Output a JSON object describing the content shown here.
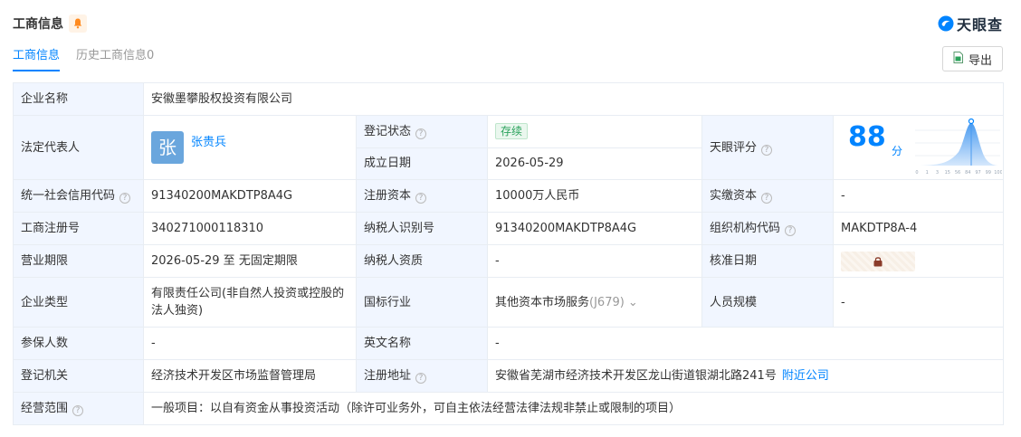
{
  "header": {
    "title": "工商信息",
    "brand": "天眼查"
  },
  "tabs": [
    {
      "label": "工商信息"
    },
    {
      "label": "历史工商信息",
      "count": "0"
    }
  ],
  "toolbar": {
    "export_label": "导出"
  },
  "company": {
    "name_label": "企业名称",
    "name": "安徽墨攀股权投资有限公司",
    "legal_rep_label": "法定代表人",
    "legal_rep_avatar": "张",
    "legal_rep": "张贵兵",
    "reg_status_label": "登记状态",
    "reg_status": "存续",
    "established_label": "成立日期",
    "established": "2026-05-29",
    "score_label": "天眼评分",
    "score": "88",
    "score_unit": "分",
    "score_axis": [
      "0",
      "1",
      "3",
      "15",
      "56",
      "84",
      "97",
      "99",
      "100"
    ],
    "credit_code_label": "统一社会信用代码",
    "credit_code": "91340200MAKDTP8A4G",
    "reg_capital_label": "注册资本",
    "reg_capital": "10000万人民币",
    "paid_capital_label": "实缴资本",
    "paid_capital": "-",
    "reg_no_label": "工商注册号",
    "reg_no": "340271000118310",
    "taxpayer_id_label": "纳税人识别号",
    "taxpayer_id": "91340200MAKDTP8A4G",
    "org_code_label": "组织机构代码",
    "org_code": "MAKDTP8A-4",
    "term_label": "营业期限",
    "term": "2026-05-29 至 无固定期限",
    "taxpayer_qual_label": "纳税人资质",
    "taxpayer_qual": "-",
    "approval_date_label": "核准日期",
    "type_label": "企业类型",
    "type": "有限责任公司(非自然人投资或控股的法人独资)",
    "industry_label": "国标行业",
    "industry": "其他资本市场服务",
    "industry_code": "(J679)",
    "staff_size_label": "人员规模",
    "staff_size": "-",
    "insured_label": "参保人数",
    "insured": "-",
    "english_name_label": "英文名称",
    "english_name": "-",
    "authority_label": "登记机关",
    "authority": "经济技术开发区市场监督管理局",
    "address_label": "注册地址",
    "address": "安徽省芜湖市经济技术开发区龙山街道银湖北路241号",
    "nearby_label": "附近公司",
    "scope_label": "经营范围",
    "scope": "一般项目：以自有资金从事投资活动（除许可业务外，可自主依法经营法律法规非禁止或限制的项目）"
  },
  "colors": {
    "accent": "#0084ff",
    "label_bg": "#f1f6ff",
    "status_green": "#2aa25c"
  }
}
